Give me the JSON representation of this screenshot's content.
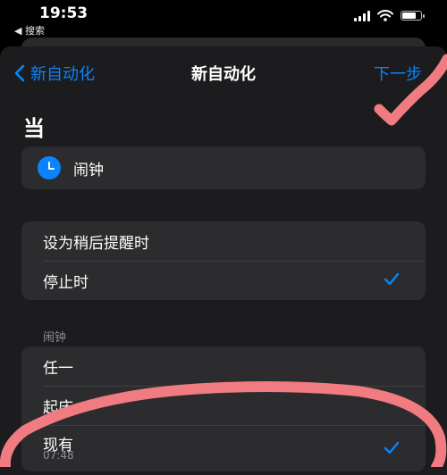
{
  "status_bar": {
    "time": "19:53",
    "back_app": "◀ 搜索"
  },
  "nav": {
    "back_label": "新自动化",
    "title": "新自动化",
    "next_label": "下一步"
  },
  "section_heading": "当",
  "trigger": {
    "label": "闹钟",
    "icon": "alarm-clock-icon"
  },
  "event_options": [
    {
      "label": "设为稍后提醒时",
      "selected": false
    },
    {
      "label": "停止时",
      "selected": true
    }
  ],
  "alarm_group": {
    "label": "闹钟",
    "items": [
      {
        "label": "任一",
        "sub": "",
        "selected": false
      },
      {
        "label": "起床",
        "sub": "",
        "selected": false
      },
      {
        "label": "现有",
        "sub": "07:48",
        "selected": true
      }
    ]
  },
  "colors": {
    "accent": "#0a84ff",
    "sheet": "#1c1c1e",
    "card": "#2c2c2e",
    "annotation": "#f07b80"
  }
}
